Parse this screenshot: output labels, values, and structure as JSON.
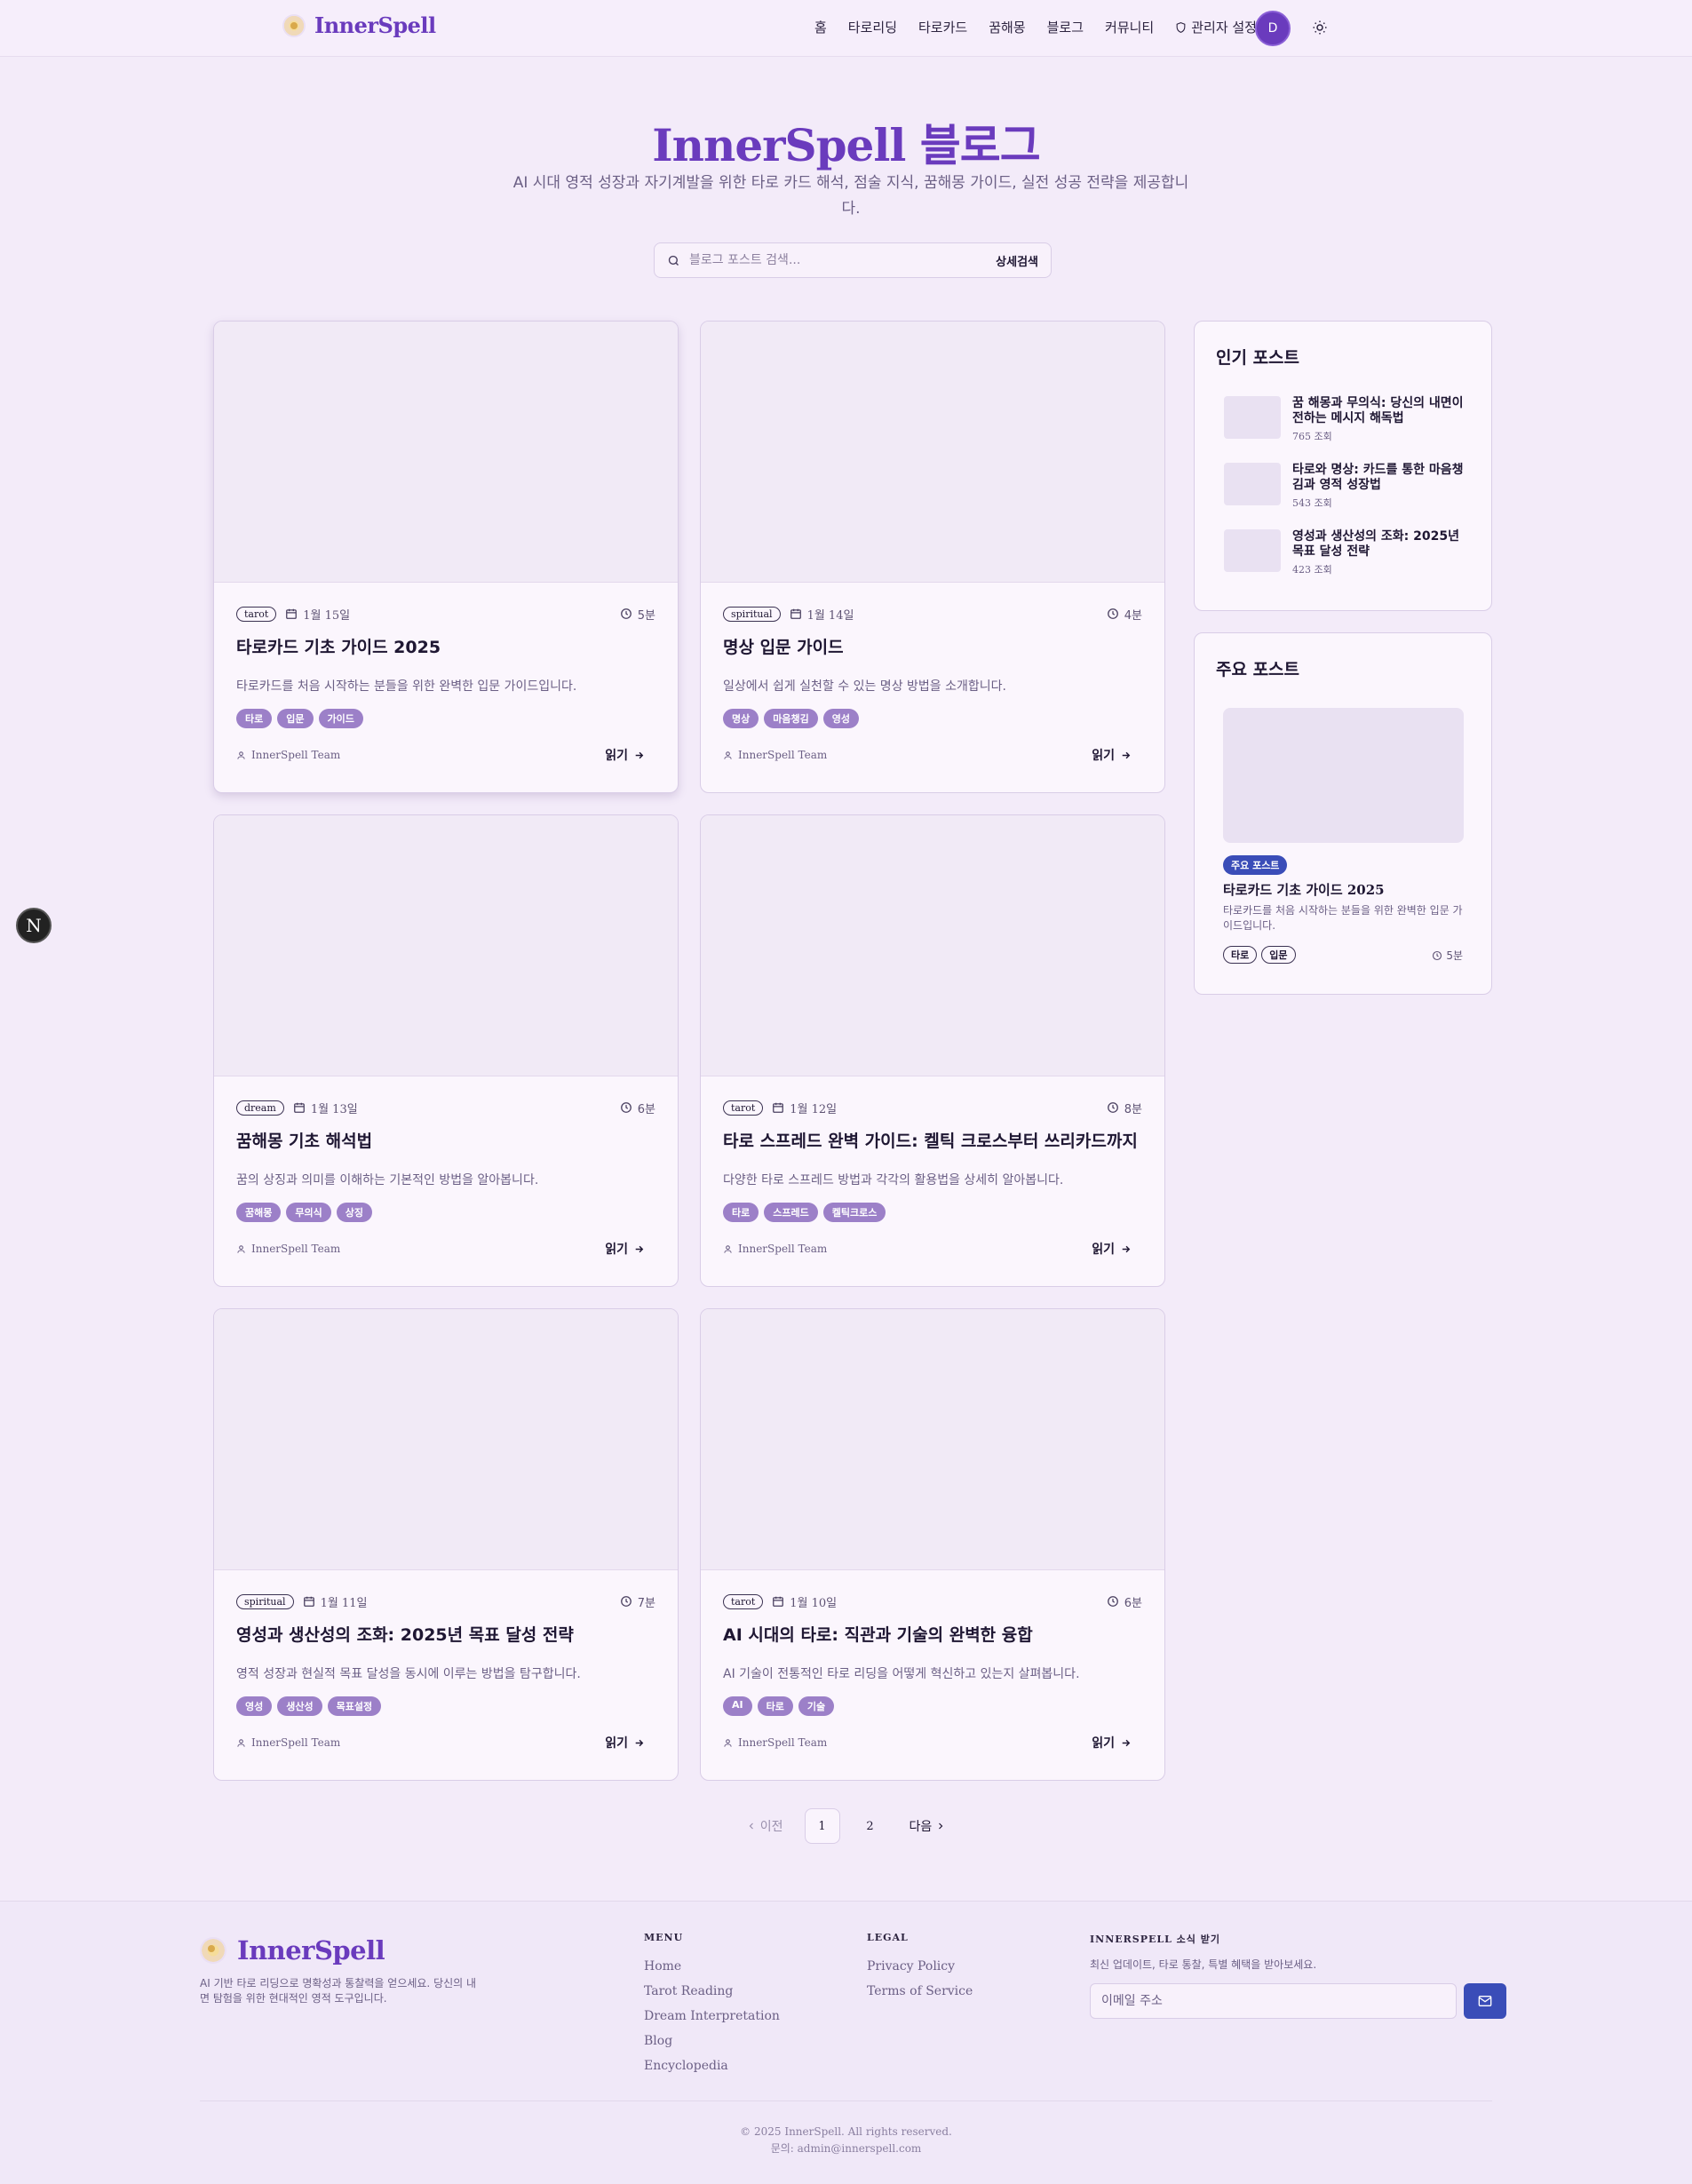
{
  "header": {
    "logo_text": "InnerSpell",
    "nav": [
      {
        "label": "홈"
      },
      {
        "label": "타로리딩"
      },
      {
        "label": "타로카드"
      },
      {
        "label": "꿈해몽"
      },
      {
        "label": "블로그"
      },
      {
        "label": "커뮤니티"
      },
      {
        "label": "관리자 설정",
        "icon": "shield-icon"
      }
    ],
    "avatar_initial": "D",
    "theme_icon": "sun-icon"
  },
  "hero": {
    "title": "InnerSpell 블로그",
    "subtitle": "AI 시대 영적 성장과 자기계발을 위한 타로 카드 해석, 점술 지식, 꿈해몽 가이드, 실전 성공 전략을 제공합니다."
  },
  "search": {
    "placeholder": "블로그 포스트 검색...",
    "advanced_label": "상세검색"
  },
  "posts": [
    {
      "category": "tarot",
      "date": "1월 15일",
      "read_time": "5분",
      "title": "타로카드 기초 가이드 2025",
      "desc": "타로카드를 처음 시작하는 분들을 위한 완벽한 입문 가이드입니다.",
      "tags": [
        "타로",
        "입문",
        "가이드"
      ],
      "author": "InnerSpell Team",
      "read_label": "읽기"
    },
    {
      "category": "spiritual",
      "date": "1월 14일",
      "read_time": "4분",
      "title": "명상 입문 가이드",
      "desc": "일상에서 쉽게 실천할 수 있는 명상 방법을 소개합니다.",
      "tags": [
        "명상",
        "마음챙김",
        "영성"
      ],
      "author": "InnerSpell Team",
      "read_label": "읽기"
    },
    {
      "category": "dream",
      "date": "1월 13일",
      "read_time": "6분",
      "title": "꿈해몽 기초 해석법",
      "desc": "꿈의 상징과 의미를 이해하는 기본적인 방법을 알아봅니다.",
      "tags": [
        "꿈해몽",
        "무의식",
        "상징"
      ],
      "author": "InnerSpell Team",
      "read_label": "읽기"
    },
    {
      "category": "tarot",
      "date": "1월 12일",
      "read_time": "8분",
      "title": "타로 스프레드 완벽 가이드: 켈틱 크로스부터 쓰리카드까지",
      "desc": "다양한 타로 스프레드 방법과 각각의 활용법을 상세히 알아봅니다.",
      "tags": [
        "타로",
        "스프레드",
        "켈틱크로스"
      ],
      "author": "InnerSpell Team",
      "read_label": "읽기"
    },
    {
      "category": "spiritual",
      "date": "1월 11일",
      "read_time": "7분",
      "title": "영성과 생산성의 조화: 2025년 목표 달성 전략",
      "desc": "영적 성장과 현실적 목표 달성을 동시에 이루는 방법을 탐구합니다.",
      "tags": [
        "영성",
        "생산성",
        "목표설정"
      ],
      "author": "InnerSpell Team",
      "read_label": "읽기"
    },
    {
      "category": "tarot",
      "date": "1월 10일",
      "read_time": "6분",
      "title": "AI 시대의 타로: 직관과 기술의 완벽한 융합",
      "desc": "AI 기술이 전통적인 타로 리딩을 어떻게 혁신하고 있는지 살펴봅니다.",
      "tags": [
        "AI",
        "타로",
        "기술"
      ],
      "author": "InnerSpell Team",
      "read_label": "읽기"
    }
  ],
  "popular": {
    "heading": "인기 포스트",
    "items": [
      {
        "title": "꿈 해몽과 무의식: 당신의 내면이 전하는 메시지 해독법",
        "views": "765 조회"
      },
      {
        "title": "타로와 명상: 카드를 통한 마음챙김과 영적 성장법",
        "views": "543 조회"
      },
      {
        "title": "영성과 생산성의 조화: 2025년 목표 달성 전략",
        "views": "423 조회"
      }
    ]
  },
  "featured": {
    "heading": "주요 포스트",
    "badge": "주요 포스트",
    "title": "타로카드 기초 가이드 2025",
    "desc": "타로카드를 처음 시작하는 분들을 위한 완벽한 입문 가이드입니다.",
    "tags": [
      "타로",
      "입문"
    ],
    "read_time": "5분"
  },
  "pagination": {
    "prev": "이전",
    "pages": [
      "1",
      "2"
    ],
    "current": "1",
    "next": "다음"
  },
  "floating_button": "N",
  "footer": {
    "logo_text": "InnerSpell",
    "tagline": "AI 기반 타로 리딩으로 명확성과 통찰력을 얻으세요. 당신의 내면 탐험을 위한 현대적인 영적 도구입니다.",
    "menu_heading": "MENU",
    "menu": [
      "Home",
      "Tarot Reading",
      "Dream Interpretation",
      "Blog",
      "Encyclopedia"
    ],
    "legal_heading": "LEGAL",
    "legal": [
      "Privacy Policy",
      "Terms of Service"
    ],
    "newsletter_heading": "INNERSPELL 소식 받기",
    "newsletter_desc": "최신 업데이트, 타로 통찰, 특별 혜택을 받아보세요.",
    "email_placeholder": "이메일 주소",
    "copyright": "© 2025 InnerSpell. All rights reserved.",
    "contact": "문의: admin@innerspell.com"
  },
  "colors": {
    "accent": "#6a3bbd",
    "tag_bg": "#9c80c8",
    "badge_blue": "#3a4db8",
    "background": "#f3ebf9"
  }
}
